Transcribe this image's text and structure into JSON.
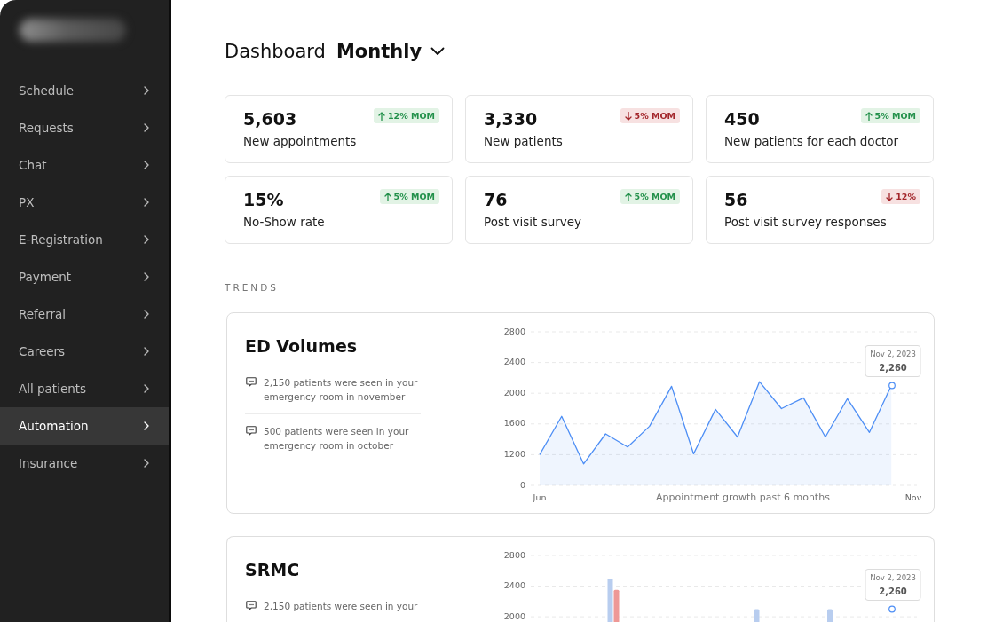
{
  "sidebar": {
    "items": [
      {
        "label": "Schedule",
        "selected": false
      },
      {
        "label": "Requests",
        "selected": false
      },
      {
        "label": "Chat",
        "selected": false
      },
      {
        "label": "PX",
        "selected": false
      },
      {
        "label": "E-Registration",
        "selected": false
      },
      {
        "label": "Payment",
        "selected": false
      },
      {
        "label": "Referral",
        "selected": false
      },
      {
        "label": "Careers",
        "selected": false
      },
      {
        "label": "All patients",
        "selected": false
      },
      {
        "label": "Automation",
        "selected": true
      },
      {
        "label": "Insurance",
        "selected": false
      }
    ]
  },
  "header": {
    "title": "Dashboard",
    "period": "Monthly"
  },
  "kpi_cards": [
    {
      "value": "5,603",
      "label": "New appointments",
      "change": "12% MOM",
      "kind": "up"
    },
    {
      "value": "3,330",
      "label": "New patients",
      "change": "5% MOM",
      "kind": "down"
    },
    {
      "value": "450",
      "label": "New patients for each doctor",
      "change": "5% MOM",
      "kind": "up"
    },
    {
      "value": "15%",
      "label": "No-Show rate",
      "change": "5% MOM",
      "kind": "up"
    },
    {
      "value": "76",
      "label": "Post visit survey",
      "change": "5% MOM",
      "kind": "up"
    },
    {
      "value": "56",
      "label": "Post visit survey responses",
      "change": "12%",
      "kind": "down"
    }
  ],
  "trends": {
    "heading": "TRENDS",
    "cards": [
      {
        "title": "ED Volumes",
        "notes": [
          "2,150 patients were seen in your emergency room in november",
          "500 patients were seen in your emergency room in october"
        ],
        "axis_bottom_label": "0",
        "chart_data": {
          "type": "area",
          "xlabel": "Appointment growth past 6 months",
          "categories": [
            "Jun",
            null,
            null,
            null,
            null,
            null,
            null,
            null,
            null,
            null,
            null,
            null,
            null,
            null,
            null,
            null,
            null,
            "Nov"
          ],
          "series": [
            {
              "color": "#4d8ef5",
              "values": [
                1200,
                1700,
                1080,
                1470,
                1300,
                1570,
                2090,
                1210,
                1790,
                1430,
                2150,
                1800,
                1940,
                1430,
                1930,
                1490,
                2100,
                null
              ]
            }
          ],
          "ylim": [
            800,
            2800
          ],
          "yticks": [
            1200,
            1600,
            2000,
            2400,
            2800
          ],
          "grid": true,
          "annotations": [
            "Nov 2, 2023",
            "2,260"
          ]
        }
      },
      {
        "title": "SRMC",
        "notes": [
          "2,150 patients were seen in your"
        ],
        "chart_data": {
          "type": "bar",
          "categories": [
            null,
            null,
            null,
            null,
            null,
            null
          ],
          "stacked": false,
          "series": [
            {
              "color": "#b8cdef",
              "values": [
                null,
                2500,
                null,
                2100,
                2100,
                null
              ]
            },
            {
              "color": "#ee9896",
              "values": [
                null,
                2350,
                null,
                null,
                null,
                null
              ]
            }
          ],
          "ylim": [
            1920,
            2800
          ],
          "yticks": [
            2000,
            2400,
            2800
          ],
          "grid": true,
          "annotations": [
            "Nov 2, 2023",
            "2,260"
          ]
        }
      }
    ]
  }
}
